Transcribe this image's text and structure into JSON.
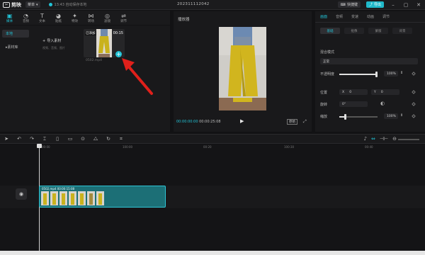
{
  "titlebar": {
    "app_name": "剪映",
    "menu_label": "菜单",
    "autosave_text": "13:43 自动保存本地",
    "project_title": "202311112042",
    "shortcut_label": "快捷键",
    "export_label": "导出"
  },
  "tool_tabs": [
    {
      "label": "媒体",
      "icon": "media-icon"
    },
    {
      "label": "音频",
      "icon": "audio-icon"
    },
    {
      "label": "文本",
      "icon": "text-icon"
    },
    {
      "label": "贴纸",
      "icon": "sticker-icon"
    },
    {
      "label": "特效",
      "icon": "effects-icon"
    },
    {
      "label": "转场",
      "icon": "transition-icon"
    },
    {
      "label": "滤镜",
      "icon": "filter-icon"
    },
    {
      "label": "调节",
      "icon": "adjust-icon"
    }
  ],
  "left_nav": {
    "item1": "本地",
    "item2": "素材库"
  },
  "media": {
    "import_label": "导入素材",
    "import_sub": "视频、音频、图片",
    "thumb_badge": "已添加",
    "thumb_duration": "00:15",
    "thumb_name": "0502.mp4"
  },
  "player": {
    "title": "播放器",
    "current_time": "00:00:00:00",
    "total_time": "00:00:25:08",
    "ratio_label": "原始"
  },
  "props": {
    "tabs": [
      "画面",
      "音频",
      "变速",
      "动画",
      "调节"
    ],
    "subtabs": [
      "基础",
      "抠像",
      "蒙版",
      "背景"
    ],
    "blend_label": "混合模式",
    "blend_value": "正常",
    "opacity_label": "不透明度",
    "opacity_value": "100%",
    "opacity_level": 1.0,
    "position_label": "位置",
    "pos_x_label": "X",
    "pos_x": "0",
    "pos_y_label": "Y",
    "pos_y": "0",
    "rotate_label": "旋转",
    "rotate_value": "0°",
    "scale_label": "缩放",
    "scale_value": "100%"
  },
  "timeline": {
    "ruler_ticks": [
      "00:00",
      "100:00",
      "00:20",
      "100:30",
      "00:40"
    ],
    "clip_label": "0502.mp4   00:00:15:08"
  },
  "colors": {
    "accent": "#22c3d6",
    "clip": "#1c6f76"
  }
}
